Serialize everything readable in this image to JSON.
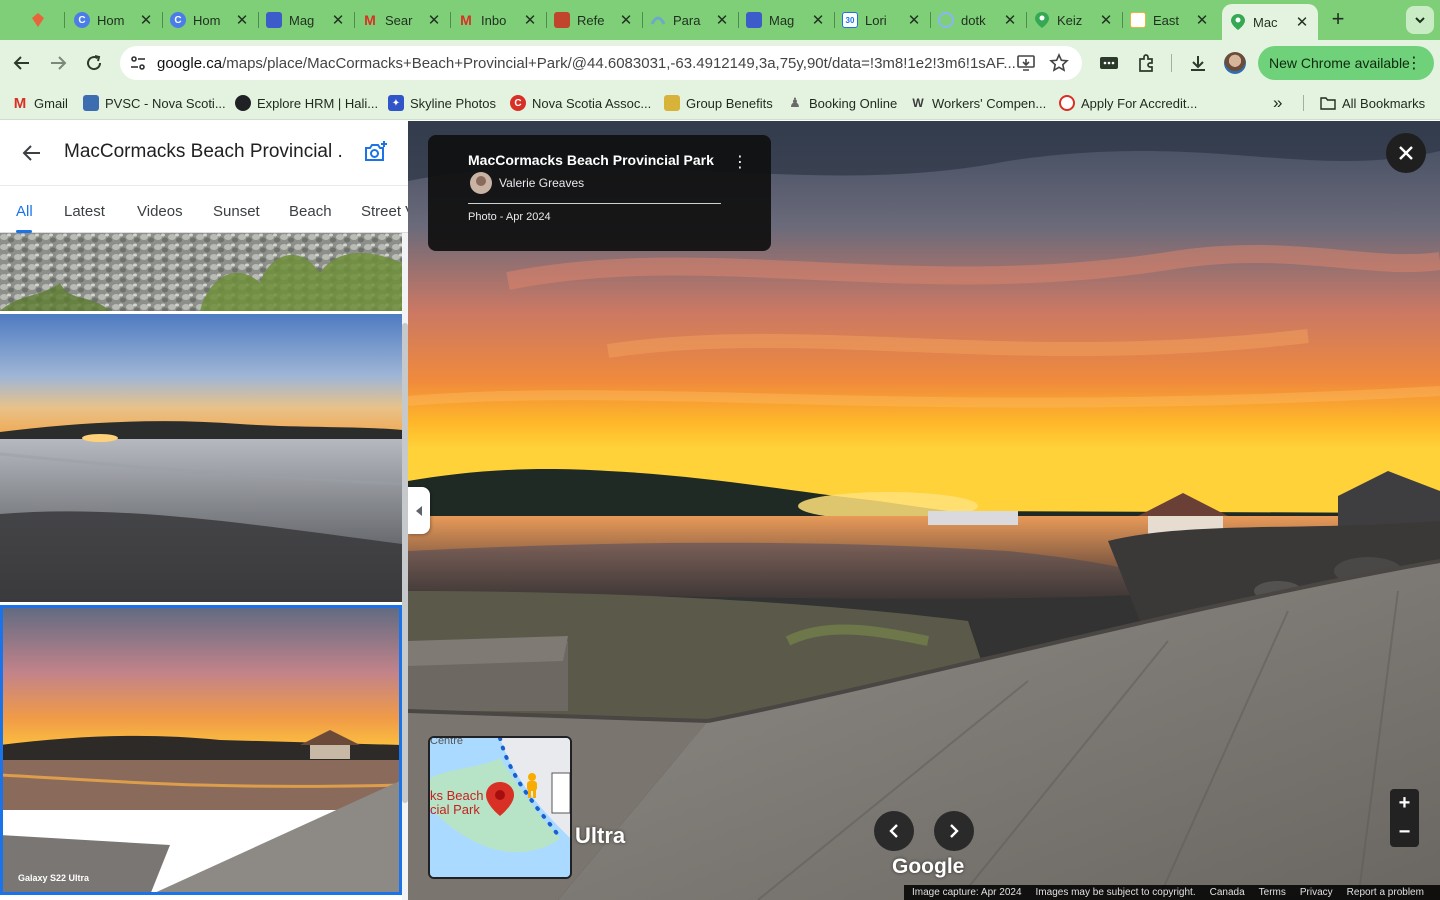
{
  "browser": {
    "tabs": [
      {
        "title": "",
        "icon": "clickup-icon",
        "color": "#e8643a"
      },
      {
        "title": "Hom",
        "icon": "c-logo-icon",
        "color": "#4a7de8"
      },
      {
        "title": "Hom",
        "icon": "c-logo-icon",
        "color": "#4a7de8"
      },
      {
        "title": "Mag",
        "icon": "print-icon",
        "color": "#3b5cc9"
      },
      {
        "title": "Sear",
        "icon": "gmail-icon",
        "color": "#d93025"
      },
      {
        "title": "Inbo",
        "icon": "gmail-icon",
        "color": "#d93025"
      },
      {
        "title": "Refe",
        "icon": "ref-icon",
        "color": "#c1452d"
      },
      {
        "title": "Para",
        "icon": "arc-icon",
        "color": "#6fa8c8"
      },
      {
        "title": "Mag",
        "icon": "print-icon",
        "color": "#3b5cc9"
      },
      {
        "title": "Lori",
        "icon": "calendar-icon",
        "color": "#1a73e8"
      },
      {
        "title": "dotk",
        "icon": "circle-icon",
        "color": "#8ab4f8"
      },
      {
        "title": "Keiz",
        "icon": "maps-icon",
        "color": "#34a853"
      },
      {
        "title": "East",
        "icon": "sheets-icon",
        "color": "#e8b53a"
      },
      {
        "title": "Mac",
        "icon": "maps-icon",
        "color": "#34a853"
      }
    ],
    "url_domain": "google.ca",
    "url_path": "/maps/place/MacCormacks+Beach+Provincial+Park/@44.6083031,-63.4912149,3a,75y,90t/data=!3m8!1e2!3m6!1sAF...",
    "update_label": "New Chrome available",
    "bookmarks": [
      {
        "label": "Gmail",
        "icon": "gmail-icon",
        "color": "#d93025"
      },
      {
        "label": "PVSC - Nova Scoti...",
        "icon": "pvsc-icon",
        "color": "#3c6db0"
      },
      {
        "label": "Explore HRM | Hali...",
        "icon": "globe-icon",
        "color": "#202124"
      },
      {
        "label": "Skyline Photos",
        "icon": "skyline-icon",
        "color": "#2f55c9"
      },
      {
        "label": "Nova Scotia Assoc...",
        "icon": "nsa-icon",
        "color": "#d93025"
      },
      {
        "label": "Group Benefits",
        "icon": "benefits-icon",
        "color": "#d8b33a"
      },
      {
        "label": "Booking Online",
        "icon": "booking-icon",
        "color": "#6a6a6a"
      },
      {
        "label": "Workers' Compen...",
        "icon": "wcb-icon",
        "color": "#3c3c3c"
      },
      {
        "label": "Apply For Accredit...",
        "icon": "accredit-icon",
        "color": "#d93025"
      }
    ],
    "all_bookmarks": "All Bookmarks",
    "more": "»"
  },
  "panel": {
    "title": "MacCormacks Beach Provincial ...",
    "tabs": [
      "All",
      "Latest",
      "Videos",
      "Sunset",
      "Beach",
      "Street V"
    ],
    "thumb_caption": "Galaxy S22 Ultra"
  },
  "viewer": {
    "card_title": "MacCormacks Beach Provincial Park",
    "author": "Valerie Greaves",
    "date": "Photo - Apr 2024",
    "map_label_1": "ks Beach",
    "map_label_2": "cial Park",
    "map_label_top": "Centre",
    "ultra": "Ultra",
    "google": "Google",
    "footer": [
      "Image capture: Apr 2024",
      "Images may be subject to copyright.",
      "Canada",
      "Terms",
      "Privacy",
      "Report a problem"
    ]
  },
  "colors": {
    "accent": "#1a73e8",
    "chrome_green": "#7fcf78",
    "update_green": "#6fd17a"
  }
}
